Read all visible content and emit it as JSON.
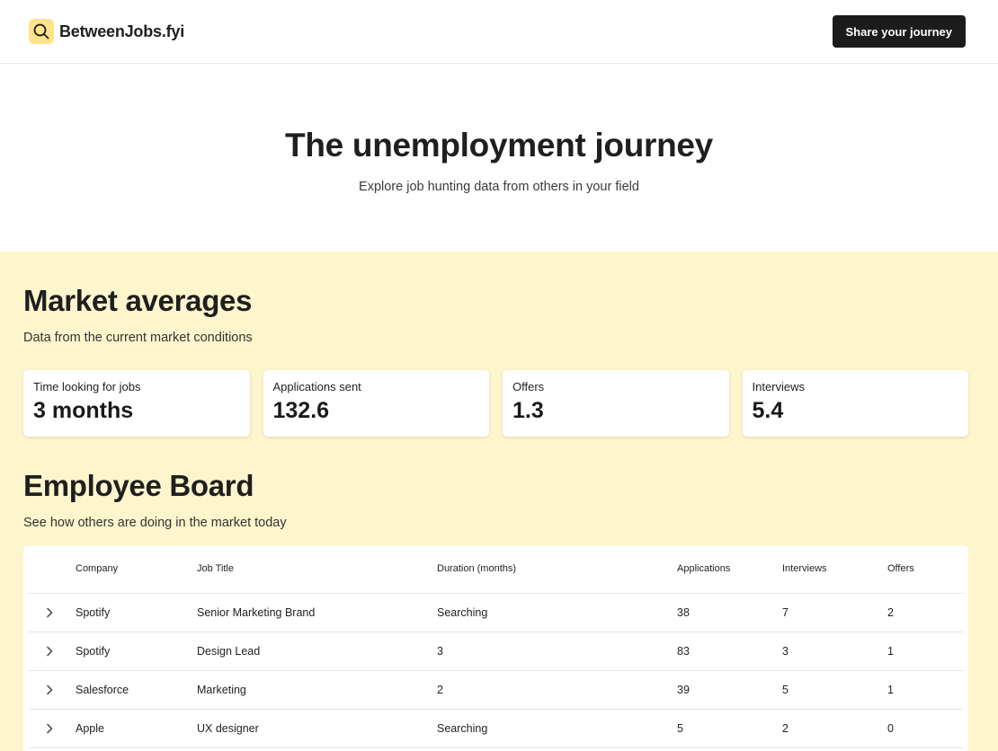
{
  "header": {
    "brand_name": "BetweenJobs.fyi",
    "share_label": "Share your journey",
    "accent_color": "#ffe38a"
  },
  "hero": {
    "title": "The unemployment journey",
    "subtitle": "Explore job hunting data from others in your field"
  },
  "market": {
    "title": "Market averages",
    "subtitle": "Data from the current market conditions",
    "stats": [
      {
        "label": "Time looking for jobs",
        "value": "3 months"
      },
      {
        "label": "Applications sent",
        "value": "132.6"
      },
      {
        "label": "Offers",
        "value": "1.3"
      },
      {
        "label": "Interviews",
        "value": "5.4"
      }
    ]
  },
  "board": {
    "title": "Employee Board",
    "subtitle": "See how others are doing in the market today",
    "columns": [
      "Company",
      "Job Title",
      "Duration (months)",
      "Applications",
      "Interviews",
      "Offers"
    ],
    "rows": [
      {
        "company": "Spotify",
        "job_title": "Senior Marketing Brand",
        "duration": "Searching",
        "applications": "38",
        "interviews": "7",
        "offers": "2"
      },
      {
        "company": "Spotify",
        "job_title": "Design Lead",
        "duration": "3",
        "applications": "83",
        "interviews": "3",
        "offers": "1"
      },
      {
        "company": "Salesforce",
        "job_title": "Marketing",
        "duration": "2",
        "applications": "39",
        "interviews": "5",
        "offers": "1"
      },
      {
        "company": "Apple",
        "job_title": "UX designer",
        "duration": "Searching",
        "applications": "5",
        "interviews": "2",
        "offers": "0"
      }
    ]
  }
}
